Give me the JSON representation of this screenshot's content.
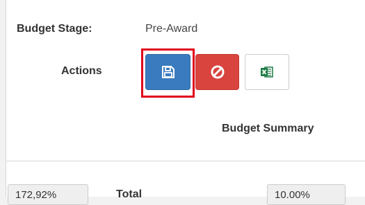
{
  "budget_stage": {
    "label": "Budget Stage:",
    "value": "Pre-Award"
  },
  "actions": {
    "label": "Actions",
    "buttons": [
      {
        "name": "save",
        "icon": "floppy-disk-icon",
        "color": "#3a7bbf"
      },
      {
        "name": "cancel",
        "icon": "prohibited-icon",
        "color": "#d9443f"
      },
      {
        "name": "export-excel",
        "icon": "excel-icon",
        "color": "#1e7b45"
      }
    ],
    "highlight_color": "#e0001b"
  },
  "summary": {
    "title": "Budget Summary",
    "total_label": "Total",
    "left_value": "172,92%",
    "right_value": "10.00%"
  }
}
